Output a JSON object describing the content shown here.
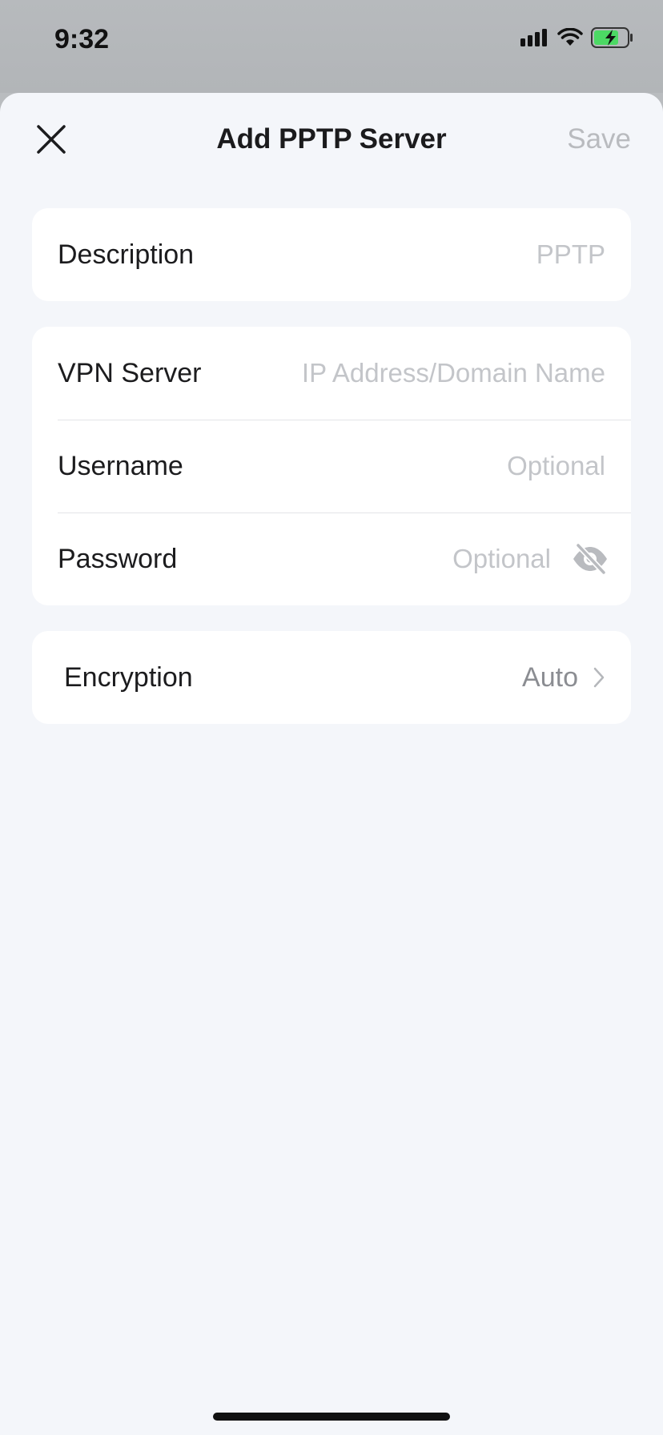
{
  "status_bar": {
    "time": "9:32",
    "icons": [
      "signal-icon",
      "wifi-icon",
      "battery-charging-icon"
    ],
    "battery_color": "#4cd964"
  },
  "header": {
    "title": "Add PPTP Server",
    "save_label": "Save",
    "close_icon": "close-icon"
  },
  "description_card": {
    "label": "Description",
    "placeholder": "PPTP",
    "value": ""
  },
  "server_card": {
    "vpn_server": {
      "label": "VPN Server",
      "placeholder": "IP Address/Domain Name",
      "value": ""
    },
    "username": {
      "label": "Username",
      "placeholder": "Optional",
      "value": ""
    },
    "password": {
      "label": "Password",
      "placeholder": "Optional",
      "value": "",
      "toggle_icon": "eye-off-icon"
    }
  },
  "encryption_card": {
    "label": "Encryption",
    "value": "Auto",
    "chevron_icon": "chevron-right-icon"
  },
  "colors": {
    "background": "#f4f6fa",
    "card": "#ffffff",
    "placeholder": "#c3c5c9",
    "save_disabled": "#b9bbbf"
  }
}
